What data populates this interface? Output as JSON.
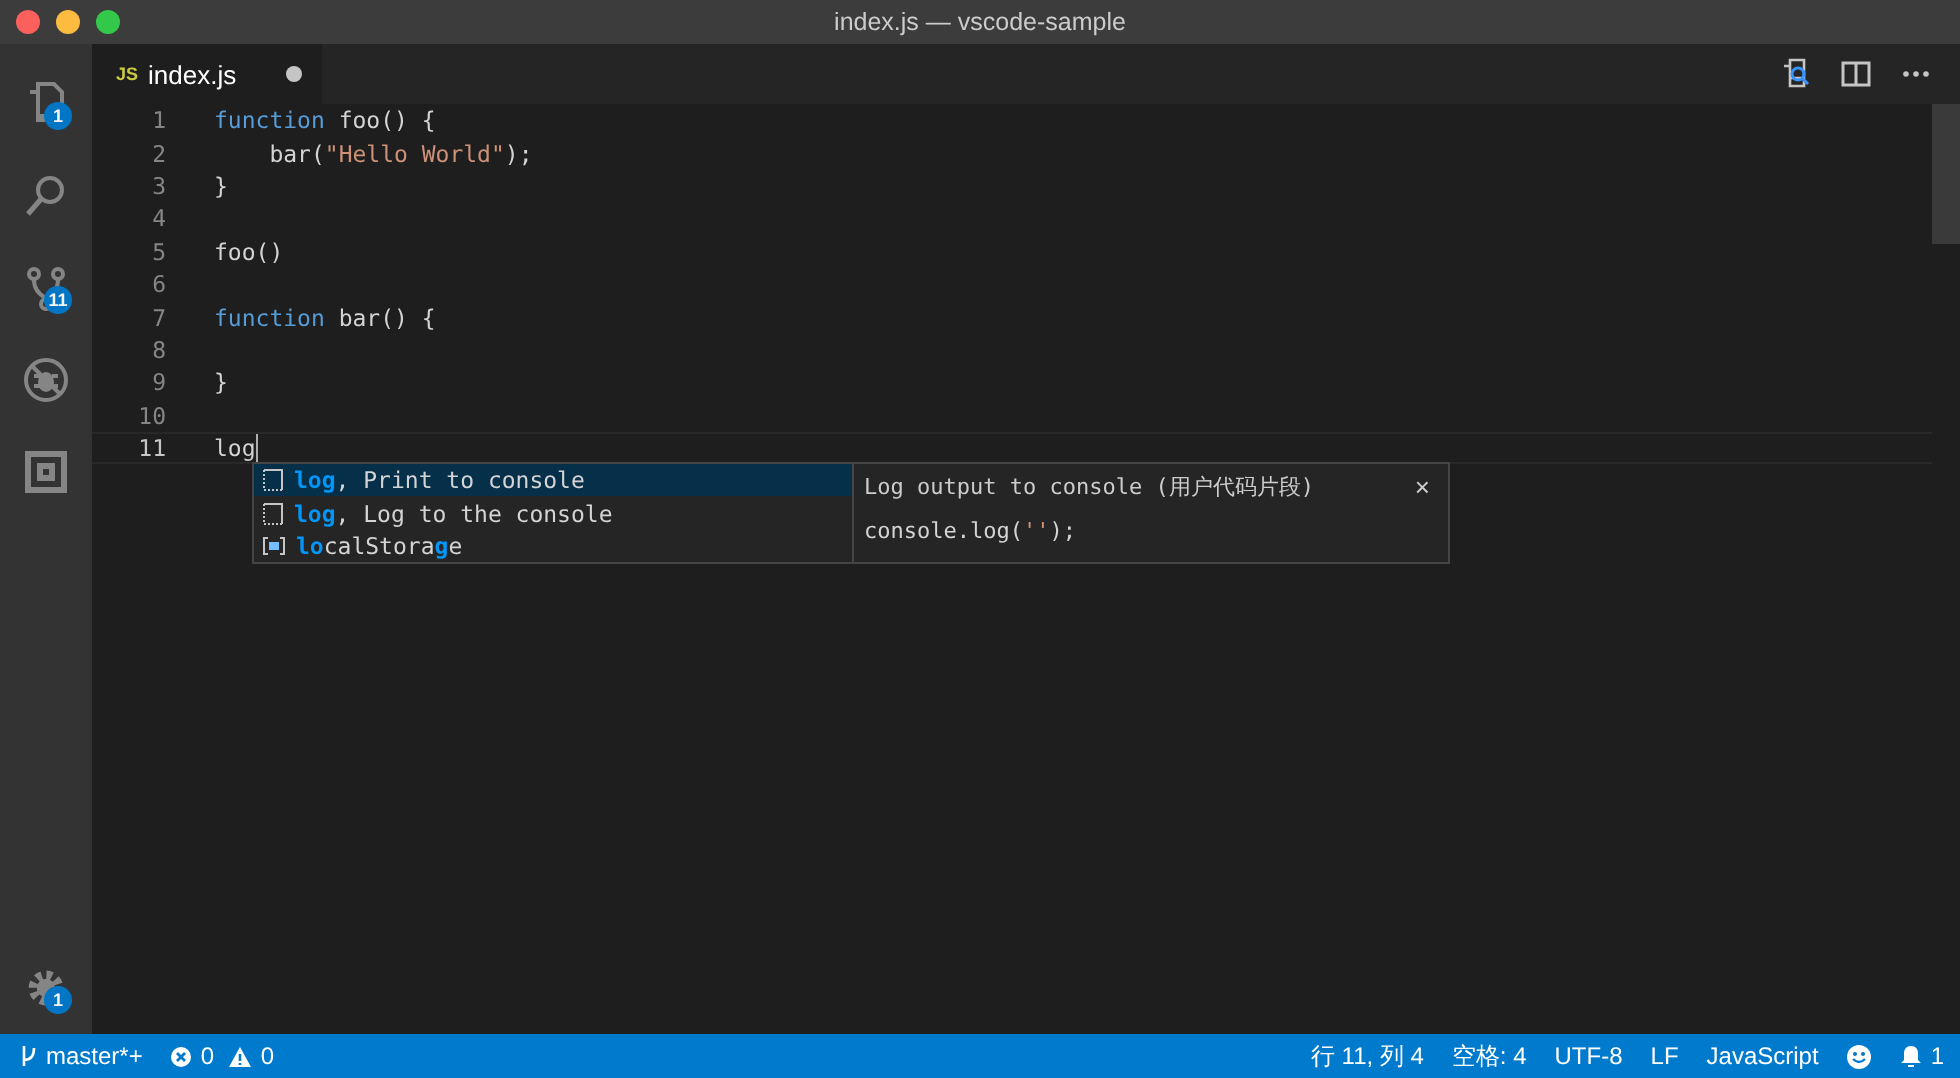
{
  "window": {
    "title": "index.js — vscode-sample"
  },
  "activity_bar": [
    {
      "kind": "files",
      "badge": "1",
      "selected": false
    },
    {
      "kind": "search",
      "selected": false
    },
    {
      "kind": "git",
      "badge": "11",
      "selected": false
    },
    {
      "kind": "debug",
      "selected": false
    },
    {
      "kind": "extensions",
      "selected": false
    }
  ],
  "settings": {
    "badge": "1"
  },
  "tabs": [
    {
      "label": "index.js",
      "icon": "JS",
      "dirty": true,
      "selected": true
    }
  ],
  "editor": {
    "lines": [
      {
        "number": "1",
        "tokens": [
          {
            "kind": "keyword",
            "text": "function"
          },
          {
            "kind": "plain",
            "text": " foo() {"
          }
        ]
      },
      {
        "number": "2",
        "tokens": [
          {
            "kind": "plain",
            "text": "    bar("
          },
          {
            "kind": "string",
            "text": "\"Hello World\""
          },
          {
            "kind": "plain",
            "text": ");"
          }
        ]
      },
      {
        "number": "3",
        "tokens": [
          {
            "kind": "plain",
            "text": "}"
          }
        ]
      },
      {
        "number": "4"
      },
      {
        "number": "5",
        "tokens": [
          {
            "kind": "plain",
            "text": "foo()"
          }
        ]
      },
      {
        "number": "6"
      },
      {
        "number": "7",
        "tokens": [
          {
            "kind": "keyword",
            "text": "function"
          },
          {
            "kind": "plain",
            "text": " bar() {"
          }
        ]
      },
      {
        "number": "8"
      },
      {
        "number": "9",
        "tokens": [
          {
            "kind": "plain",
            "text": "}"
          }
        ]
      },
      {
        "number": "10"
      },
      {
        "number": "11",
        "tokens": [
          {
            "kind": "plain",
            "text": "log"
          }
        ],
        "current": true
      }
    ]
  },
  "suggestions": {
    "items": [
      {
        "kind": "snippet",
        "label": "**log**, Print to console",
        "selected": true
      },
      {
        "kind": "snippet",
        "label": "**log**, Log to the console",
        "selected": false
      },
      {
        "kind": "variable",
        "label": "**lo**calStora**g**e",
        "selected": false
      }
    ],
    "detail": {
      "title": "Log output to console (用户代码片段)",
      "close": "×",
      "code": [
        {
          "kind": "plain",
          "text": "console.log("
        },
        {
          "kind": "string",
          "text": "''"
        },
        {
          "kind": "plain",
          "text": ");"
        }
      ]
    }
  },
  "status_bar": {
    "branch": "master*+",
    "errors": "0",
    "warnings": "0",
    "position": "行 11, 列 4",
    "indent": "空格: 4",
    "encoding": "UTF-8",
    "eol": "LF",
    "language": "JavaScript",
    "notifications": "1"
  }
}
